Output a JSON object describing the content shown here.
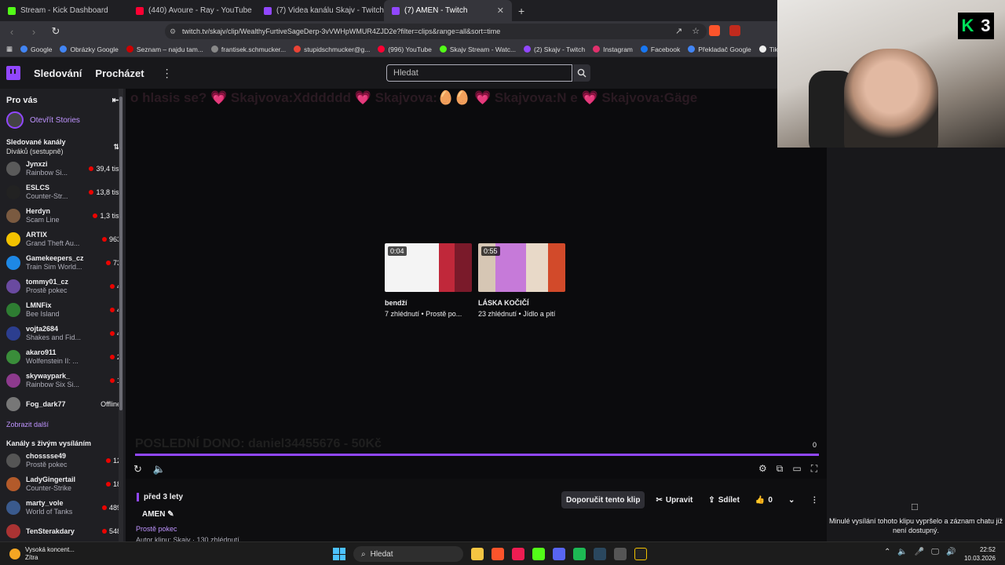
{
  "browser": {
    "tabs": [
      {
        "title": "Stream - Kick Dashboard",
        "color": "#53fc18"
      },
      {
        "title": "(440) Avoure - Ray - YouTube",
        "color": "#ff0033"
      },
      {
        "title": "(7) Videa kanálu Skajv - Twitch",
        "color": "#9147ff"
      },
      {
        "title": "(7) AMEN - Twitch",
        "color": "#9147ff",
        "active": true
      }
    ],
    "new_tab": "+",
    "close": "✕",
    "url": "twitch.tv/skajv/clip/WealthyFurtiveSageDerp-3vVWHpWMUR4ZJD2e?filter=clips&range=all&sort=time",
    "bookmarks": [
      {
        "label": "Google",
        "color": "#4285f4"
      },
      {
        "label": "Obrázky Google",
        "color": "#4285f4"
      },
      {
        "label": "Seznam – najdu tam...",
        "color": "#cc0000"
      },
      {
        "label": "frantisek.schmucker...",
        "color": "#888"
      },
      {
        "label": "stupidschmucker@g...",
        "color": "#ea4335"
      },
      {
        "label": "(996) YouTube",
        "color": "#ff0033"
      },
      {
        "label": "Skajv Stream - Watc...",
        "color": "#53fc18"
      },
      {
        "label": "(2) Skajv - Twitch",
        "color": "#9147ff"
      },
      {
        "label": "Instagram",
        "color": "#e1306c"
      },
      {
        "label": "Facebook",
        "color": "#1877f2"
      },
      {
        "label": "Překladač Google",
        "color": "#4285f4"
      },
      {
        "label": "TikTok",
        "color": "#eee"
      }
    ]
  },
  "twitch": {
    "nav": {
      "following": "Sledování",
      "browse": "Procházet",
      "more": "⋮",
      "search_placeholder": "Hledat"
    },
    "sidebar": {
      "title": "Pro vás",
      "collapse": "⇤",
      "stories": "Otevřít Stories",
      "followed_title": "Sledované kanály",
      "followed_sort": "Diváků (sestupně)",
      "sort_icon": "⇅",
      "channels": [
        {
          "name": "Jynxzi",
          "game": "Rainbow Si...",
          "viewers": "39,4 tis.",
          "color": "#5a5a5a"
        },
        {
          "name": "ESLCS",
          "game": "Counter-Str...",
          "viewers": "13,8 tis.",
          "color": "#222"
        },
        {
          "name": "Herdyn",
          "game": "Scam Line",
          "viewers": "1,3 tis.",
          "color": "#7a5a40"
        },
        {
          "name": "ARTIX",
          "game": "Grand Theft Au...",
          "viewers": "963",
          "color": "#f2c200"
        },
        {
          "name": "Gamekeepers_cz",
          "game": "Train Sim World...",
          "viewers": "73",
          "color": "#1e88e5"
        },
        {
          "name": "tommy01_cz",
          "game": "Prostě pokec",
          "viewers": "4",
          "color": "#6a4aa0"
        },
        {
          "name": "LMNFix",
          "game": "Bee Island",
          "viewers": "4",
          "color": "#2e7d32"
        },
        {
          "name": "vojta2684",
          "game": "Shakes and Fid...",
          "viewers": "4",
          "color": "#2c3e8f"
        },
        {
          "name": "akaro911",
          "game": "Wolfenstein II: ...",
          "viewers": "2",
          "color": "#3a8d3a"
        },
        {
          "name": "skywaypark_",
          "game": "Rainbow Six Si...",
          "viewers": "1",
          "color": "#8d3a8d"
        }
      ],
      "offline_channel": {
        "name": "Fog_dark77",
        "status": "Offline",
        "color": "#777"
      },
      "show_more": "Zobrazit další",
      "live_title": "Kanály s živým vysíláním",
      "live_channels": [
        {
          "name": "chosssse49",
          "game": "Prostě pokec",
          "viewers": "12",
          "color": "#555"
        },
        {
          "name": "LadyGingertail",
          "game": "Counter-Strike",
          "viewers": "18",
          "color": "#b35a2a"
        },
        {
          "name": "marty_vole",
          "game": "World of Tanks",
          "viewers": "489",
          "color": "#3a5a8d"
        },
        {
          "name": "TenSterakdary",
          "game": "",
          "viewers": "548",
          "color": "#a33"
        }
      ]
    },
    "player": {
      "chat_overlay": "o hlasis se? 💗 Skajvova:Xdddddd 💗 Skajvova:🥚🥚 💗 Skajvova:N e 💗 Skajvova:Gäge",
      "donation_overlay": "POSLEDNÍ DONO: daniel34455676 - 50Kč",
      "recommended": [
        {
          "duration": "0:04",
          "title": "bendží",
          "meta": "7 zhlédnutí • Prostě po..."
        },
        {
          "duration": "0:55",
          "title": "LÁSKA KOČIČÍ",
          "meta": "23 zhlédnutí • Jídlo a pití"
        }
      ],
      "time": "0",
      "progress": 1.0
    },
    "clip": {
      "ago": "před 3 lety",
      "title": "AMEN",
      "game": "Prostě pokec",
      "author": "Autor klipu: Skajv · 130 zhlédnutí",
      "recommend": "Doporučit tento klip",
      "edit": "Upravit",
      "share": "Sdílet",
      "likes": "0"
    },
    "chat_notice": "Minulé vysílání tohoto klipu vypršelo a záznam chatu již není dostupný."
  },
  "webcam": {
    "logo_letter": "K",
    "logo_number": "3"
  },
  "taskbar": {
    "weather_title": "Vysoká koncent...",
    "weather_sub": "Zítra",
    "search": "Hledat",
    "time": "22:52",
    "date": "10.03.2026"
  }
}
